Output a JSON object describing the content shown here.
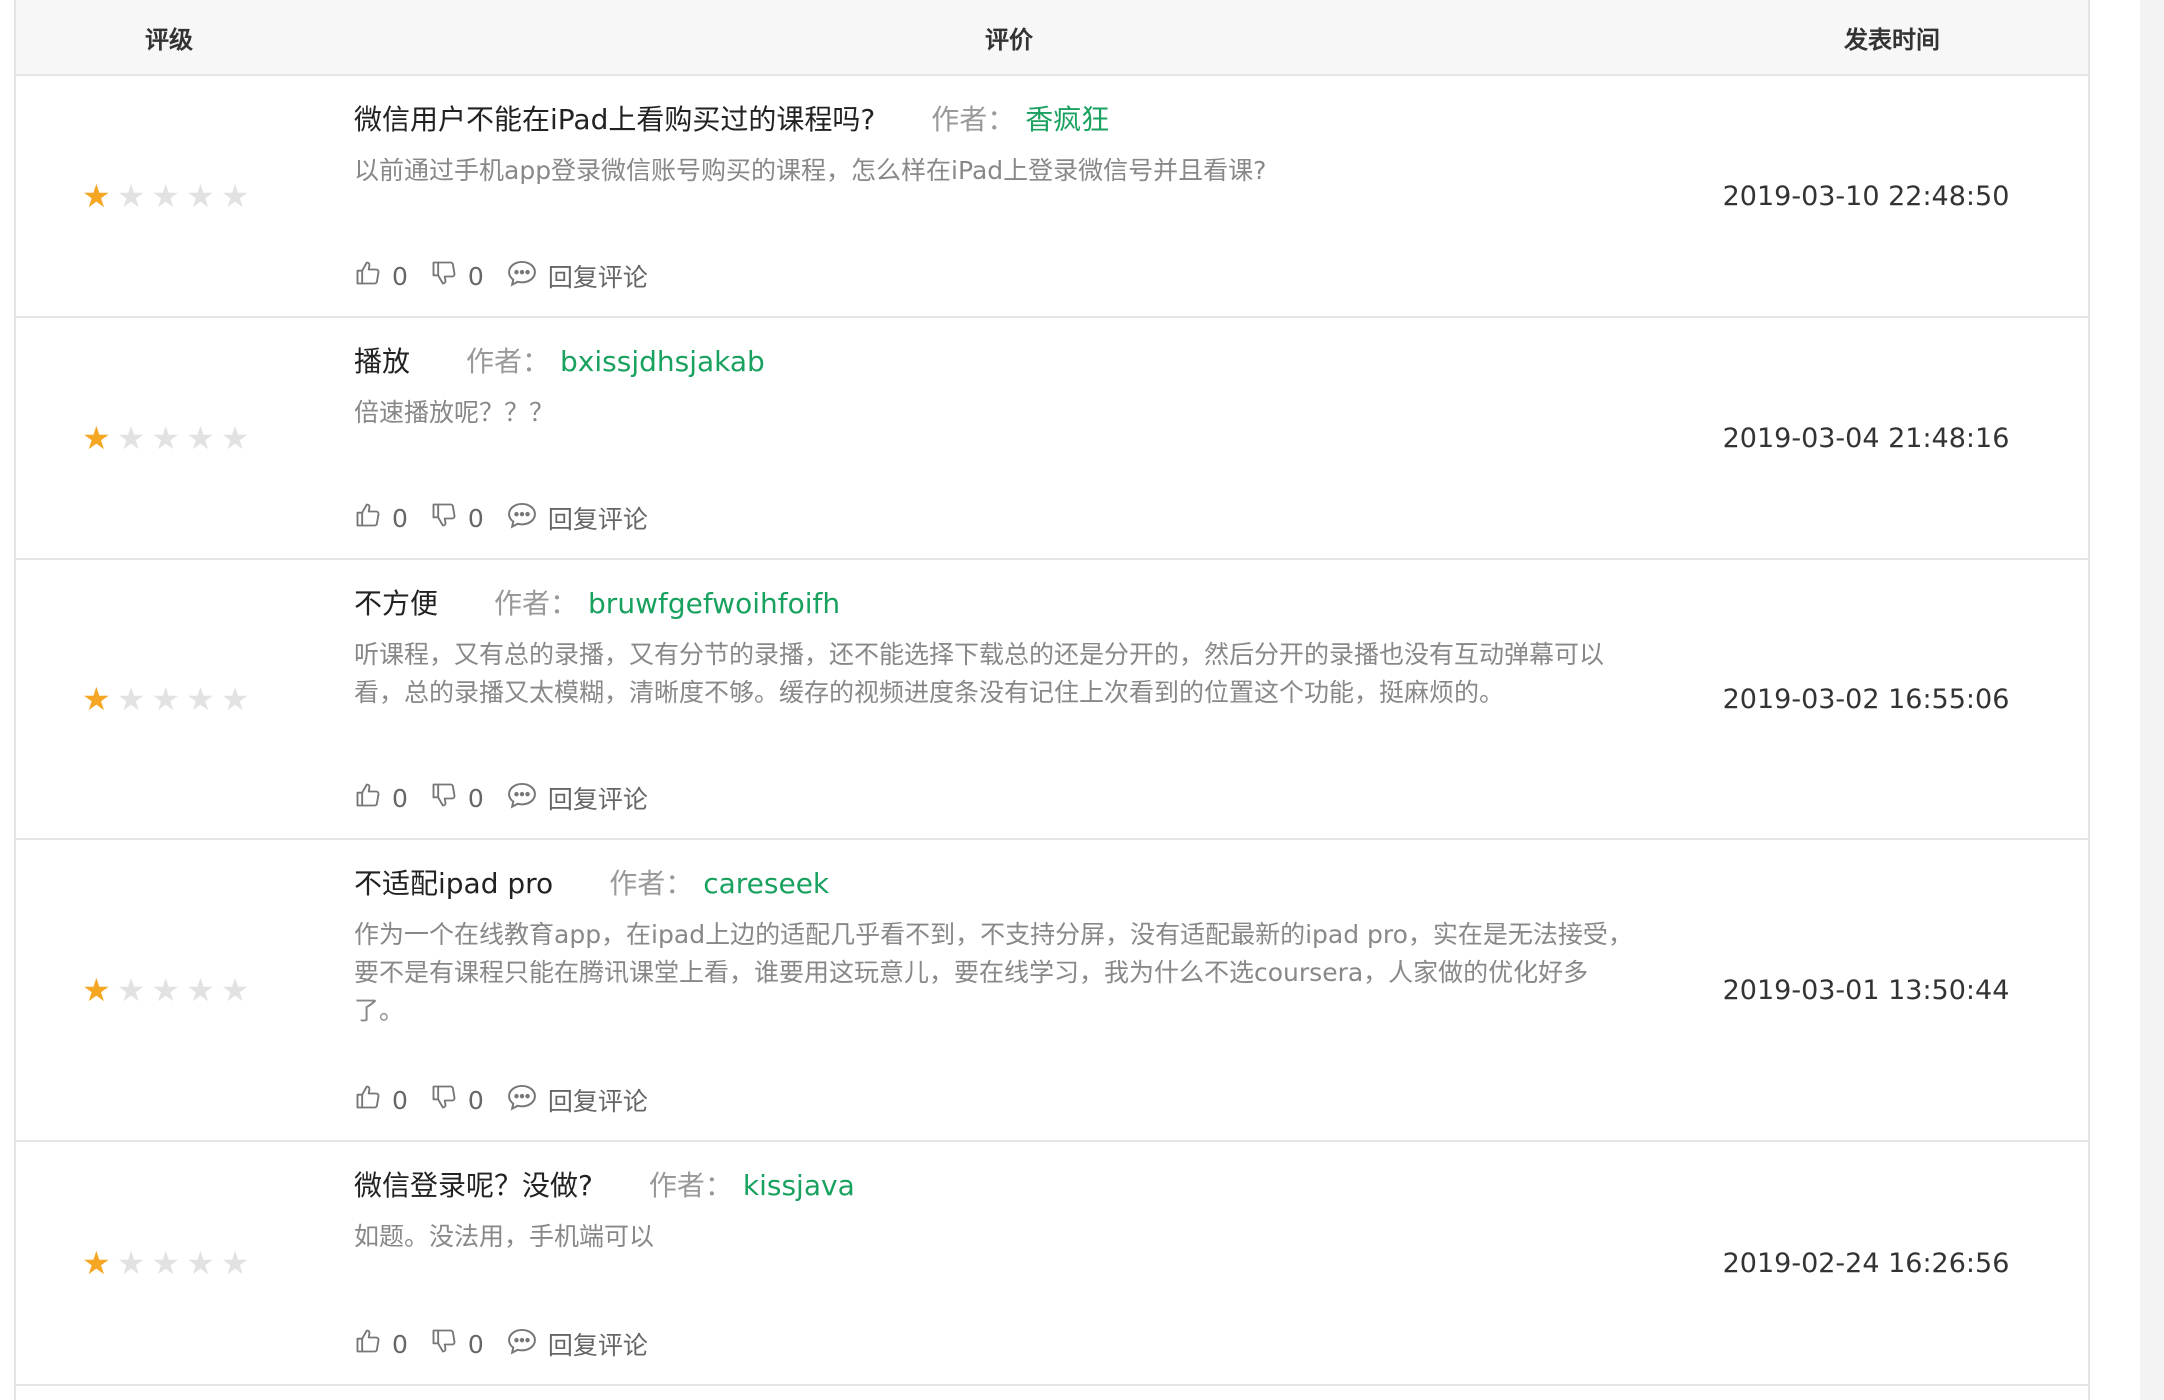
{
  "header": {
    "rating": "评级",
    "review": "评价",
    "time": "发表时间"
  },
  "labels": {
    "author": "作者：",
    "reply": "回复评论"
  },
  "colors": {
    "accent": "#19a15f",
    "star": "#f5a623"
  },
  "reviews": [
    {
      "title": "微信用户不能在iPad上看购买过的课程吗?",
      "author": "香疯狂",
      "content": "以前通过手机app登录微信账号购买的课程，怎么样在iPad上登录微信号并且看课?",
      "rating": 1,
      "likes": "0",
      "dislikes": "0",
      "time": "2019-03-10 22:48:50"
    },
    {
      "title": "播放",
      "author": "bxissjdhsjakab",
      "content": "倍速播放呢？？？",
      "rating": 1,
      "likes": "0",
      "dislikes": "0",
      "time": "2019-03-04 21:48:16"
    },
    {
      "title": "不方便",
      "author": "bruwfgefwoihfoifh",
      "content": "听课程，又有总的录播，又有分节的录播，还不能选择下载总的还是分开的，然后分开的录播也没有互动弹幕可以看，总的录播又太模糊，清晰度不够。缓存的视频进度条没有记住上次看到的位置这个功能，挺麻烦的。",
      "rating": 1,
      "likes": "0",
      "dislikes": "0",
      "time": "2019-03-02 16:55:06"
    },
    {
      "title": "不适配ipad pro",
      "author": "careseek",
      "content": "作为一个在线教育app，在ipad上边的适配几乎看不到，不支持分屏，没有适配最新的ipad pro，实在是无法接受，要不是有课程只能在腾讯课堂上看，谁要用这玩意儿，要在线学习，我为什么不选coursera，人家做的优化好多了。",
      "rating": 1,
      "likes": "0",
      "dislikes": "0",
      "time": "2019-03-01 13:50:44"
    },
    {
      "title": "微信登录呢？没做?",
      "author": "kissjava",
      "content": "如题。没法用，手机端可以",
      "rating": 1,
      "likes": "0",
      "dislikes": "0",
      "time": "2019-02-24 16:26:56"
    }
  ]
}
